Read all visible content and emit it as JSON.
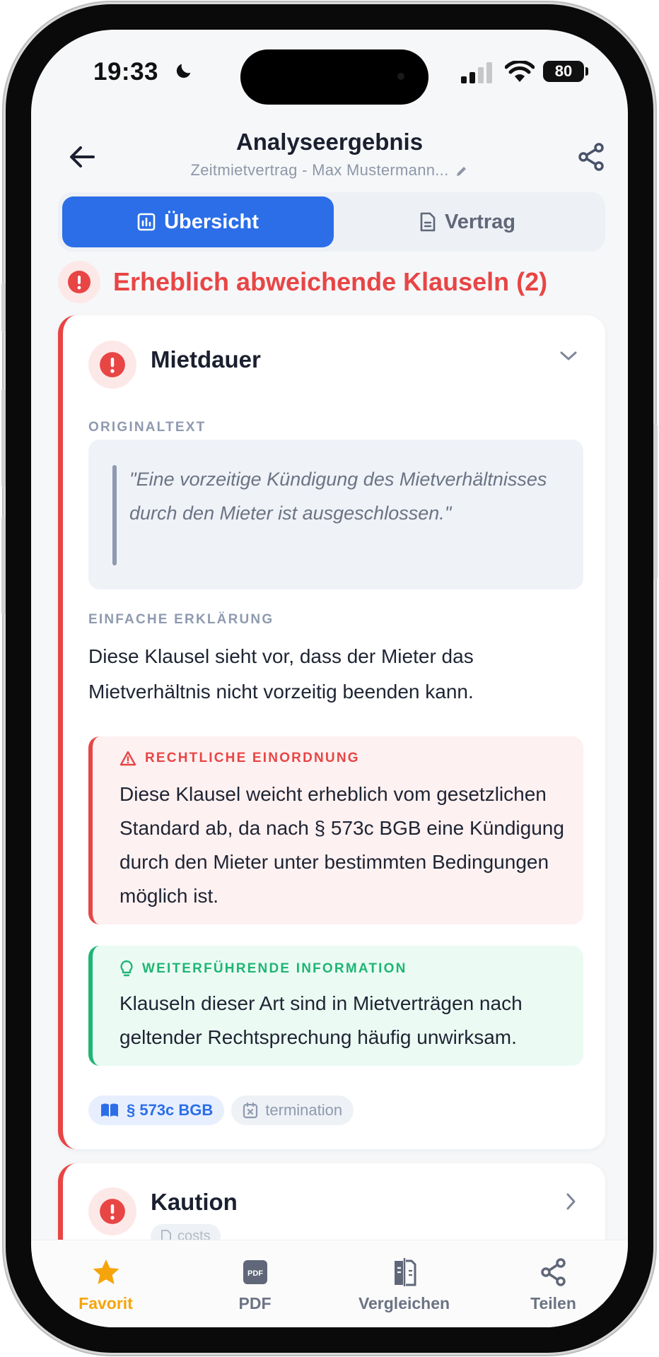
{
  "status_bar": {
    "time": "19:33",
    "battery": "80"
  },
  "header": {
    "title": "Analyseergebnis",
    "subtitle": "Zeitmietvertrag - Max Mustermann..."
  },
  "tabs": {
    "overview": "Übersicht",
    "contract": "Vertrag"
  },
  "section": {
    "title": "Erheblich abweichende Klauseln (2)"
  },
  "clause1": {
    "title": "Mietdauer",
    "original_label": "ORIGINALTEXT",
    "original_text": "\"Eine vorzeitige Kündigung des Mietverhältnisses durch den Mieter ist ausgeschlossen.\"",
    "explanation_label": "EINFACHE ERKLÄRUNG",
    "explanation_text": "Diese Klausel sieht vor, dass der Mieter das Mietverhältnis nicht vorzeitig beenden kann.",
    "legal_label": "RECHTLICHE EINORDNUNG",
    "legal_text": "Diese Klausel weicht erheblich vom gesetzlichen Standard ab, da nach § 573c BGB eine Kündigung durch den Mieter unter bestimmten Bedingungen möglich ist.",
    "info_label": "WEITERFÜHRENDE INFORMATION",
    "info_text": "Klauseln dieser Art sind in Mietverträgen nach geltender Rechtsprechung häufig unwirksam.",
    "tags": [
      "§ 573c BGB",
      "termination"
    ]
  },
  "clause2": {
    "title": "Kaution",
    "tag": "costs"
  },
  "bottom_nav": {
    "favorite": "Favorit",
    "pdf": "PDF",
    "pdf_icon_text": "PDF",
    "compare": "Vergleichen",
    "share": "Teilen"
  },
  "colors": {
    "primary": "#2b6ee8",
    "danger": "#e84545",
    "success": "#1fb574",
    "favorite": "#f5a50b"
  }
}
